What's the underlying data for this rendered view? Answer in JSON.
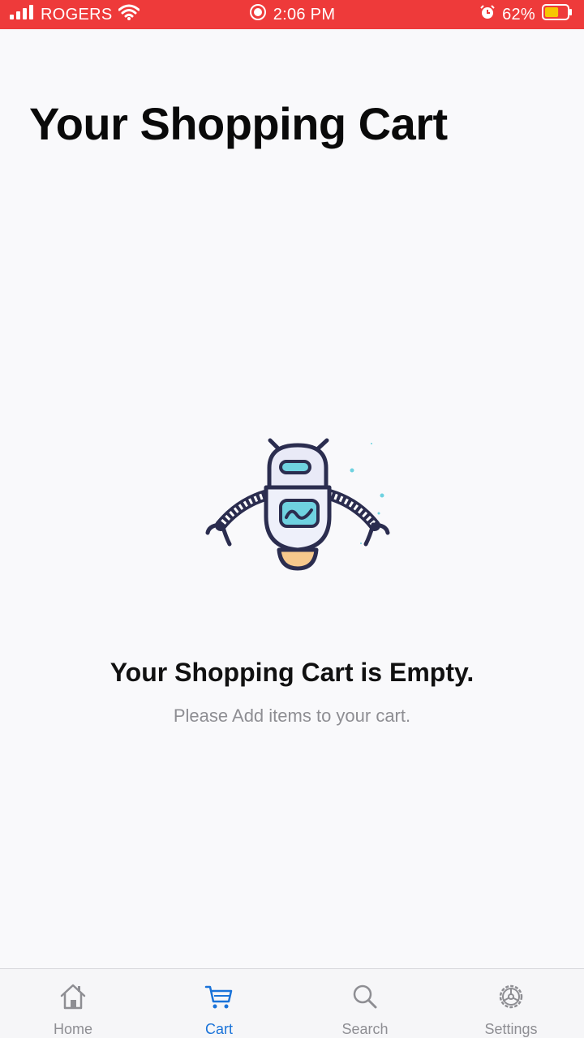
{
  "status_bar": {
    "carrier": "ROGERS",
    "time": "2:06 PM",
    "battery_percent": "62%",
    "battery_level": 0.62,
    "bar_color": "#ee3a3a"
  },
  "page": {
    "title": "Your Shopping Cart"
  },
  "empty_state": {
    "illustration": "robot-illustration",
    "title": "Your Shopping Cart is Empty.",
    "subtitle": "Please Add items to your cart."
  },
  "tab_bar": {
    "active_color": "#1a73d9",
    "inactive_color": "#8e8e93",
    "tabs": [
      {
        "label": "Home",
        "icon": "home-icon",
        "active": false
      },
      {
        "label": "Cart",
        "icon": "cart-icon",
        "active": true
      },
      {
        "label": "Search",
        "icon": "search-icon",
        "active": false
      },
      {
        "label": "Settings",
        "icon": "settings-icon",
        "active": false
      }
    ]
  }
}
